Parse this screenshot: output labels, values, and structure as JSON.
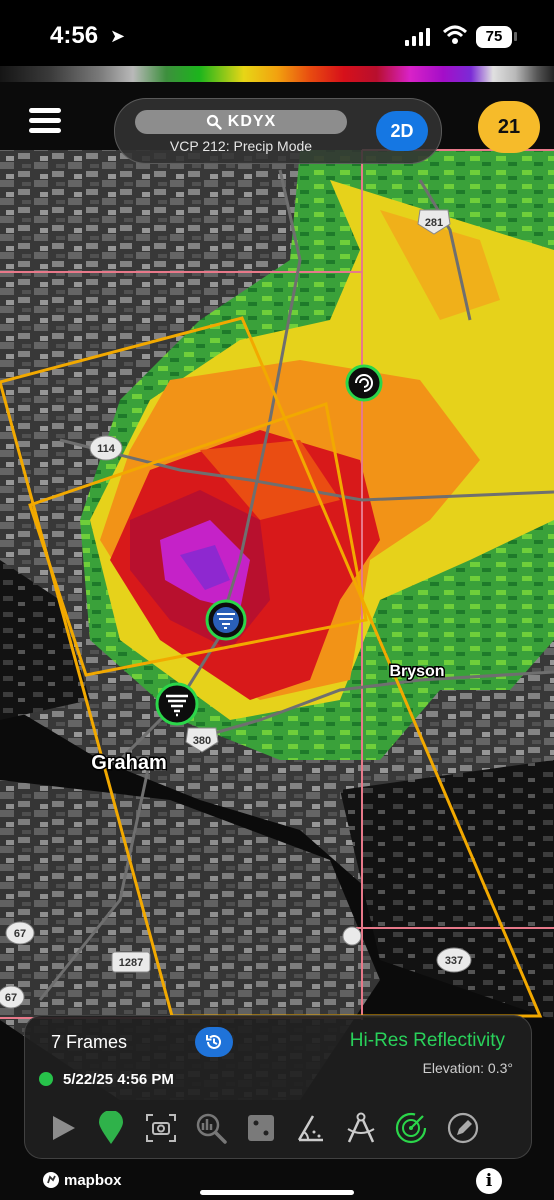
{
  "status_bar": {
    "time": "4:56",
    "battery": "75"
  },
  "radar": {
    "station": "KDYX",
    "scan_mode": "VCP 212: Precip Mode",
    "view_mode": "2D",
    "alert_count": "21"
  },
  "map": {
    "places": {
      "graham": "Graham",
      "bryson": "Bryson"
    },
    "shields": {
      "us281": "281",
      "sh114": "114",
      "us380": "380",
      "sh67a": "67",
      "sh67b": "67",
      "fm1287": "1287",
      "sh337": "337"
    },
    "attribution": "mapbox"
  },
  "player": {
    "frames": "7 Frames",
    "product": "Hi-Res Reflectivity",
    "timestamp": "5/22/25 4:56 PM",
    "elevation": "Elevation: 0.3°"
  },
  "colors": {
    "accent_blue": "#1577e3",
    "alert_amber": "#f6bb2a",
    "product_green": "#29d15a",
    "warning_outline": "#f2a900"
  }
}
